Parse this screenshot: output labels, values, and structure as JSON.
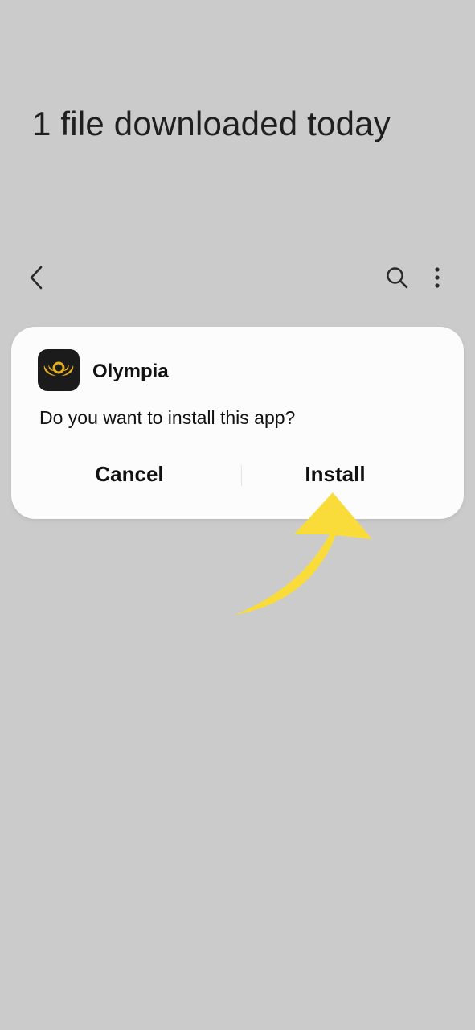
{
  "header": {
    "title": "1 file downloaded today"
  },
  "toolbar": {
    "back_icon": "chevron-left-icon",
    "search_icon": "search-icon",
    "more_icon": "more-vertical-icon"
  },
  "dialog": {
    "app_name": "Olympia",
    "app_icon": "olympia-logo-icon",
    "question": "Do you want to install this app?",
    "cancel_label": "Cancel",
    "install_label": "Install"
  },
  "annotation": {
    "arrow_color": "#f9dc3a",
    "arrow_icon": "curved-arrow-up-icon"
  },
  "colors": {
    "background": "#cbcbcb",
    "dialog": "#fcfcfc",
    "icon_bg": "#1b1b1b",
    "logo_gold": "#e5ad20"
  }
}
